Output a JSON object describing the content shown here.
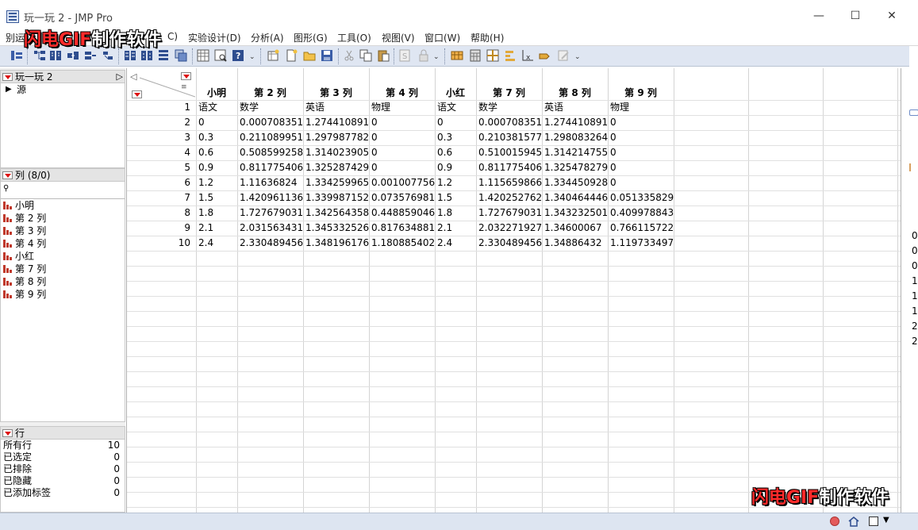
{
  "window": {
    "title": "玩一玩 2 - JMP Pro",
    "minimize": "—",
    "maximize": "☐",
    "close": "✕"
  },
  "watermark_text": "闪电GIF制作软件",
  "watermark_parts": {
    "red": "闪电GIF",
    "white": "制作软件"
  },
  "menu": [
    "别运",
    "C)",
    "实验设计(D)",
    "分析(A)",
    "图形(G)",
    "工具(O)",
    "视图(V)",
    "窗口(W)",
    "帮助(H)"
  ],
  "left": {
    "table_panel": {
      "title": "玩一玩 2",
      "source": "源"
    },
    "columns_panel": {
      "title": "列 (8/0)",
      "search_glyph": "⚲",
      "columns": [
        "小明",
        "第 2 列",
        "第 3 列",
        "第 4 列",
        "小红",
        "第 7 列",
        "第 8 列",
        "第 9 列"
      ]
    },
    "rows_panel": {
      "title": "行",
      "items": [
        {
          "label": "所有行",
          "value": "10"
        },
        {
          "label": "已选定",
          "value": "0"
        },
        {
          "label": "已排除",
          "value": "0"
        },
        {
          "label": "已隐藏",
          "value": "0"
        },
        {
          "label": "已添加标签",
          "value": "0"
        }
      ]
    }
  },
  "grid": {
    "headers": [
      "小明",
      "第 2 列",
      "第 3 列",
      "第 4 列",
      "小红",
      "第 7 列",
      "第 8 列",
      "第 9 列"
    ],
    "rows": [
      [
        "1",
        "语文",
        "数学",
        "英语",
        "物理",
        "语文",
        "数学",
        "英语",
        "物理"
      ],
      [
        "2",
        "0",
        "0.000708351",
        "1.274410891",
        "0",
        "0",
        "0.000708351",
        "1.274410891",
        "0"
      ],
      [
        "3",
        "0.3",
        "0.211089951",
        "1.297987782",
        "0",
        "0.3",
        "0.210381577",
        "1.298083264",
        "0"
      ],
      [
        "4",
        "0.6",
        "0.508599258",
        "1.314023905",
        "0",
        "0.6",
        "0.510015945",
        "1.314214755",
        "0"
      ],
      [
        "5",
        "0.9",
        "0.811775406",
        "1.325287429",
        "0",
        "0.9",
        "0.811775406",
        "1.325478279",
        "0"
      ],
      [
        "6",
        "1.2",
        "1.11636824",
        "1.334259965",
        "0.001007756",
        "1.2",
        "1.115659866",
        "1.334450928",
        "0"
      ],
      [
        "7",
        "1.5",
        "1.420961136",
        "1.339987152",
        "0.073576981",
        "1.5",
        "1.420252762",
        "1.340464446",
        "0.051335829"
      ],
      [
        "8",
        "1.8",
        "1.727679031",
        "1.342564358",
        "0.448859046",
        "1.8",
        "1.727679031",
        "1.343232501",
        "0.409978843"
      ],
      [
        "9",
        "2.1",
        "2.031563431",
        "1.345332526",
        "0.817634881",
        "2.1",
        "2.032271927",
        "1.34600067",
        "0.766115722"
      ],
      [
        "10",
        "2.4",
        "2.330489456",
        "1.348196176",
        "1.180885402",
        "2.4",
        "2.330489456",
        "1.34886432",
        "1.119733497"
      ]
    ]
  },
  "right_strip_chars": [
    "0",
    "0",
    "0",
    "1",
    "1",
    "1",
    "2",
    "2"
  ]
}
